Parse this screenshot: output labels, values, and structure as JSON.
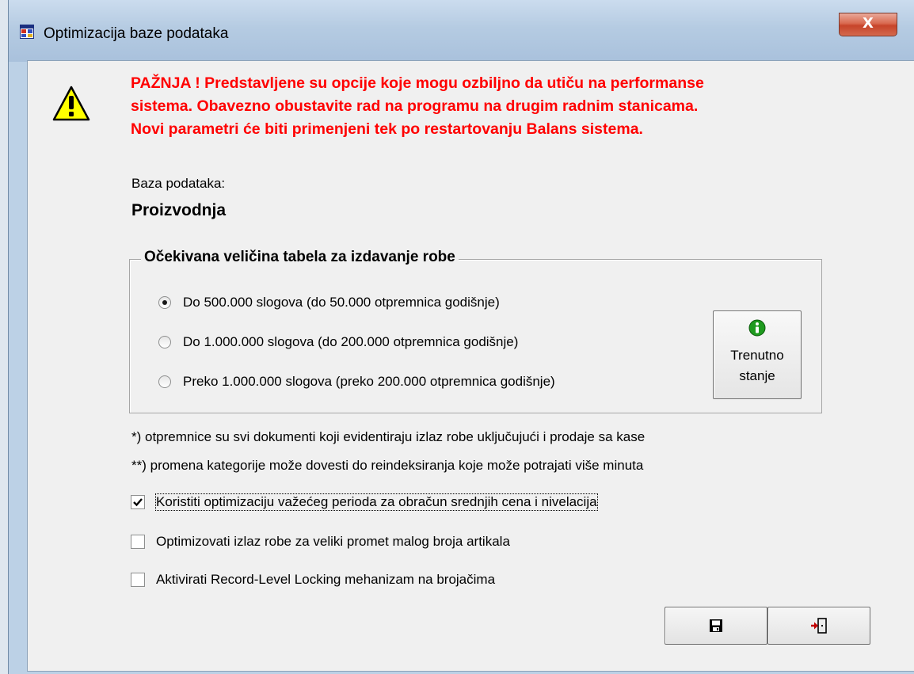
{
  "window": {
    "title": "Optimizacija baze podataka",
    "close_label": "X"
  },
  "warning": {
    "line1": "PAŽNJA ! Predstavljene su opcije koje mogu ozbiljno da utiču na performanse",
    "line2": "sistema. Obavezno obustavite rad na programu na drugim radnim stanicama.",
    "line3": "Novi parametri će biti primenjeni tek po restartovanju Balans sistema.",
    "color": "#ff0000",
    "icon": "warning-icon"
  },
  "database": {
    "label": "Baza podataka:",
    "value": "Proizvodnja"
  },
  "table_size_group": {
    "legend": "Očekivana veličina tabela za izdavanje robe",
    "options": [
      {
        "label": "Do 500.000 slogova (do 50.000 otpremnica godišnje)",
        "selected": true
      },
      {
        "label": "Do 1.000.000 slogova (do 200.000 otpremnica godišnje)",
        "selected": false
      },
      {
        "label": "Preko 1.000.000 slogova (preko 200.000 otpremnica godišnje)",
        "selected": false
      }
    ],
    "current_state_button": {
      "line1": "Trenutno",
      "line2": "stanje",
      "icon": "info-icon"
    }
  },
  "notes": {
    "note1": "*) otpremnice su svi dokumenti koji evidentiraju izlaz robe uključujući i prodaje sa kase",
    "note2": "**) promena kategorije može dovesti do reindeksiranja koje može potrajati više minuta"
  },
  "checkboxes": [
    {
      "label": "Koristiti optimizaciju važećeg perioda za obračun srednjih cena i nivelacija",
      "checked": true
    },
    {
      "label": "Optimizovati izlaz robe za veliki promet malog broja artikala",
      "checked": false
    },
    {
      "label": "Aktivirati Record-Level Locking mehanizam na brojačima",
      "checked": false
    }
  ],
  "footer": {
    "save_icon": "save-icon",
    "exit_icon": "exit-icon"
  }
}
